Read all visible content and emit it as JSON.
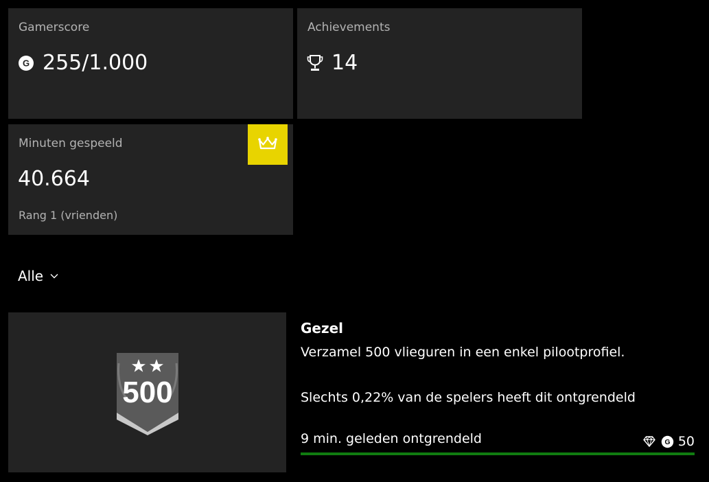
{
  "stats": {
    "gamerscore": {
      "label": "Gamerscore",
      "value": "255/1.000"
    },
    "achievements": {
      "label": "Achievements",
      "value": "14"
    },
    "minutes": {
      "label": "Minuten gespeeld",
      "value": "40.664",
      "rank": "Rang 1 (vrienden)"
    }
  },
  "filter": {
    "label": "Alle"
  },
  "achievement": {
    "badge_text": "500",
    "title": "Gezel",
    "description": "Verzamel 500 vlieguren in een enkel pilootprofiel.",
    "rarity": "Slechts 0,22% van de spelers heeft dit ontgrendeld",
    "unlocked": "9 min. geleden ontgrendeld",
    "points": "50",
    "progress": 1.0
  },
  "colors": {
    "tile_background": "#232323",
    "crown_badge": "#e8d400",
    "progress_green": "#107c10"
  },
  "icons": {
    "gamerscore": "gamerscore-g-icon",
    "achievements": "trophy-icon",
    "rank": "crown-icon",
    "filter": "chevron-down-icon",
    "rarity": "diamond-icon"
  }
}
